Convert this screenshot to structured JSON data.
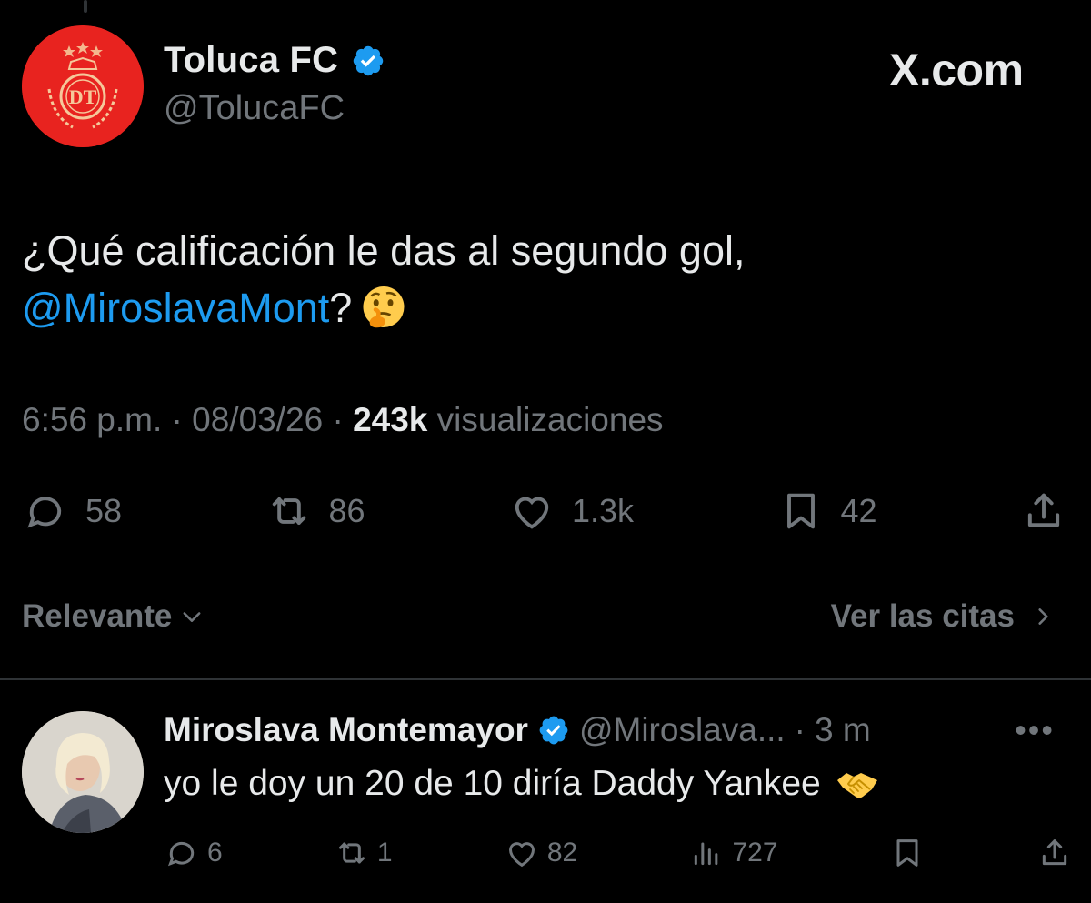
{
  "brand": "X.com",
  "tweet": {
    "display_name": "Toluca FC",
    "handle": "@TolucaFC",
    "text_line1": "¿Qué calificación le das al segundo gol,",
    "mention": "@MiroslavaMont",
    "text_after_mention": "?",
    "emoji": "thinking-face",
    "time": "6:56 p.m.",
    "date": "08/03/26",
    "views_count": "243k",
    "views_label": "visualizaciones",
    "replies": "58",
    "reposts": "86",
    "likes": "1.3k",
    "bookmarks": "42"
  },
  "sort": {
    "label": "Relevante",
    "quotes_label": "Ver las citas"
  },
  "reply": {
    "display_name": "Miroslava Montemayor",
    "handle": "@Miroslava...",
    "time": "3 m",
    "text": "yo le doy un 20 de 10 diría Daddy Yankee",
    "emoji": "handshake",
    "replies": "6",
    "reposts": "1",
    "likes": "82",
    "views": "727"
  },
  "colors": {
    "accent": "#1d9bf0",
    "muted": "#71767b",
    "text": "#e7e9ea",
    "background": "#000000"
  }
}
